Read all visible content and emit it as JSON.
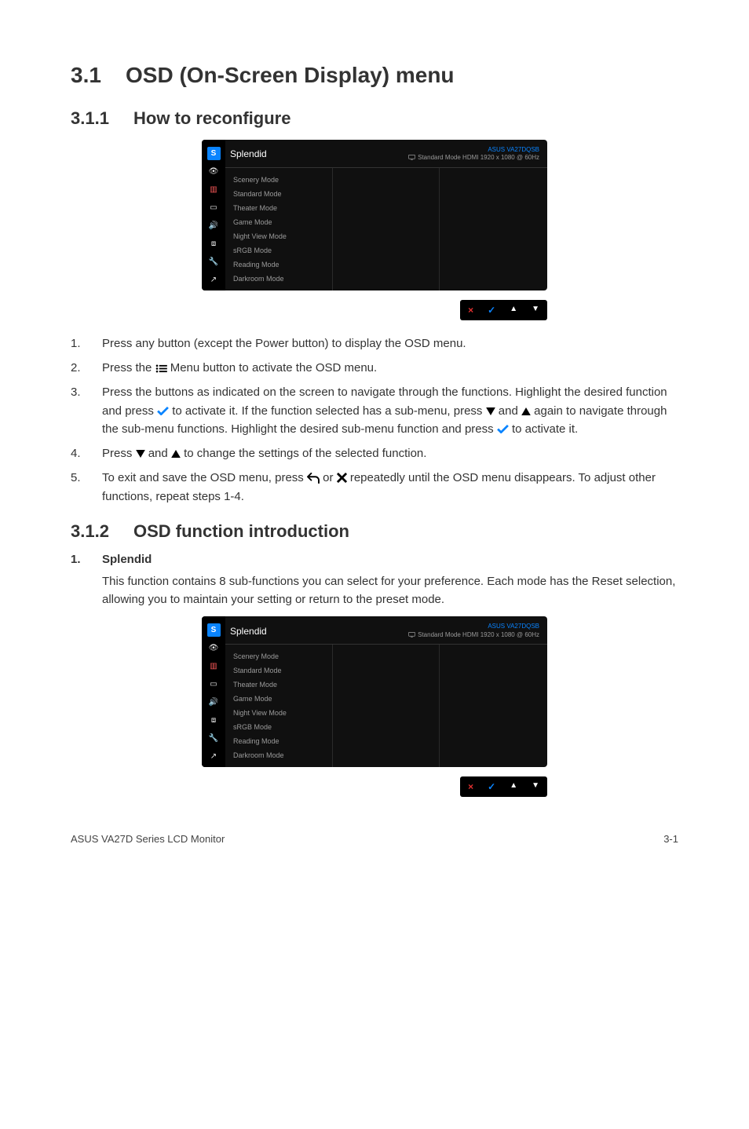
{
  "meta": {
    "product_footer": "ASUS VA27D Series LCD Monitor",
    "page_num": "3-1"
  },
  "title": {
    "num": "3.1",
    "text": "OSD (On-Screen Display) menu"
  },
  "section_1": {
    "num": "3.1.1",
    "text": "How to reconfigure"
  },
  "osd": {
    "menu_title": "Splendid",
    "model": "ASUS VA27DQSB",
    "mode_line": "Standard Mode   HDMI 1920 x 1080 @ 60Hz",
    "items": [
      "Scenery Mode",
      "Standard Mode",
      "Theater Mode",
      "Game Mode",
      "Night View Mode",
      "sRGB Mode",
      "Reading Mode",
      "Darkroom Mode"
    ],
    "nav": {
      "close": "×",
      "confirm": "✓",
      "up": "▲",
      "down": "▼"
    }
  },
  "steps": {
    "s1": "Press any button (except the Power button) to display the OSD menu.",
    "s2a": "Press the ",
    "s2b": " Menu button to activate the OSD menu.",
    "s3a": "Press the buttons as indicated on the screen to navigate through the functions. Highlight the desired function and press ",
    "s3b": " to activate it. If the function selected has a sub-menu, press ",
    "s3c": " and ",
    "s3d": " again to navigate through the sub-menu functions. Highlight the desired sub-menu function and press ",
    "s3e": " to activate it.",
    "s4a": "Press ",
    "s4b": " and ",
    "s4c": " to change the settings of the selected function.",
    "s5a": "To exit and save the OSD menu, press ",
    "s5b": " or ",
    "s5c": " repeatedly until the OSD menu disappears. To adjust other functions, repeat steps 1-4."
  },
  "section_2": {
    "num": "3.1.2",
    "text": "OSD function introduction"
  },
  "splendid": {
    "sub_num": "1.",
    "sub_title": "Splendid",
    "para": "This function contains 8 sub-functions you can select for your preference. Each mode has the Reset selection, allowing you to maintain your setting or return to the preset mode."
  }
}
